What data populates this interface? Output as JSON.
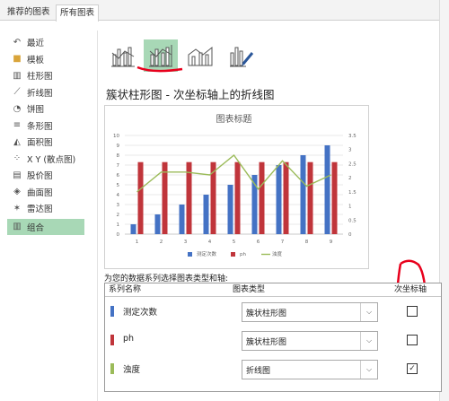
{
  "tabs": [
    "推荐的图表",
    "所有图表"
  ],
  "sidebar": {
    "items": [
      {
        "label": "最近",
        "icon": "recent-icon"
      },
      {
        "label": "模板",
        "icon": "folder-icon"
      },
      {
        "label": "柱形图",
        "icon": "column-chart-icon"
      },
      {
        "label": "折线图",
        "icon": "line-chart-icon"
      },
      {
        "label": "饼图",
        "icon": "pie-chart-icon"
      },
      {
        "label": "条形图",
        "icon": "bar-chart-icon"
      },
      {
        "label": "面积图",
        "icon": "area-chart-icon"
      },
      {
        "label": "X Y (散点图)",
        "icon": "scatter-chart-icon"
      },
      {
        "label": "股价图",
        "icon": "stock-chart-icon"
      },
      {
        "label": "曲面图",
        "icon": "surface-chart-icon"
      },
      {
        "label": "雷达图",
        "icon": "radar-chart-icon"
      },
      {
        "label": "组合",
        "icon": "combo-chart-icon",
        "selected": true
      }
    ]
  },
  "subtypes": [
    {
      "icon": "combo-column-line-icon",
      "selected": false
    },
    {
      "icon": "combo-column-line-secondary-icon",
      "selected": true
    },
    {
      "icon": "combo-stacked-area-column-icon",
      "selected": false
    },
    {
      "icon": "custom-combo-icon",
      "selected": false
    }
  ],
  "combo_title": "簇状柱形图 - 次坐标轴上的折线图",
  "chart_data": {
    "type": "bar",
    "title": "图表标题",
    "categories": [
      "1",
      "2",
      "3",
      "4",
      "5",
      "6",
      "7",
      "8",
      "9"
    ],
    "series": [
      {
        "name": "测定次数",
        "type": "bar",
        "axis": "primary",
        "values": [
          1,
          2,
          3,
          4,
          5,
          6,
          7,
          8,
          9
        ]
      },
      {
        "name": "ph",
        "type": "bar",
        "axis": "primary",
        "values": [
          7.3,
          7.3,
          7.3,
          7.3,
          7.3,
          7.3,
          7.3,
          7.3,
          7.3
        ]
      },
      {
        "name": "浊度",
        "type": "line",
        "axis": "secondary",
        "values": [
          1.5,
          2.2,
          2.2,
          2.1,
          2.8,
          1.6,
          2.6,
          1.7,
          2.1
        ]
      }
    ],
    "y_ticks": [
      "0",
      "1",
      "2",
      "3",
      "4",
      "5",
      "6",
      "7",
      "8",
      "9",
      "10"
    ],
    "y2_ticks": [
      "0",
      "0.5",
      "1",
      "1.5",
      "2",
      "2.5",
      "3",
      "3.5"
    ],
    "ylim": [
      0,
      10
    ],
    "y2lim": [
      0,
      3.5
    ],
    "grid": true,
    "legend": "bottom"
  },
  "series_prompt": "为您的数据系列选择图表类型和轴:",
  "table": {
    "col_name": "系列名称",
    "col_type": "图表类型",
    "col_secondary": "次坐标轴",
    "rows": [
      {
        "name": "测定次数",
        "type": "簇状柱形图",
        "secondary": false
      },
      {
        "name": "ph",
        "type": "簇状柱形图",
        "secondary": false
      },
      {
        "name": "浊度",
        "type": "折线图",
        "secondary": true
      }
    ]
  },
  "colors": {
    "blue_series": "#4472c4",
    "red_series": "#c0353b",
    "green_series": "#9bbb59",
    "selection": "#a8d8b6",
    "annotation": "#e8001c"
  }
}
